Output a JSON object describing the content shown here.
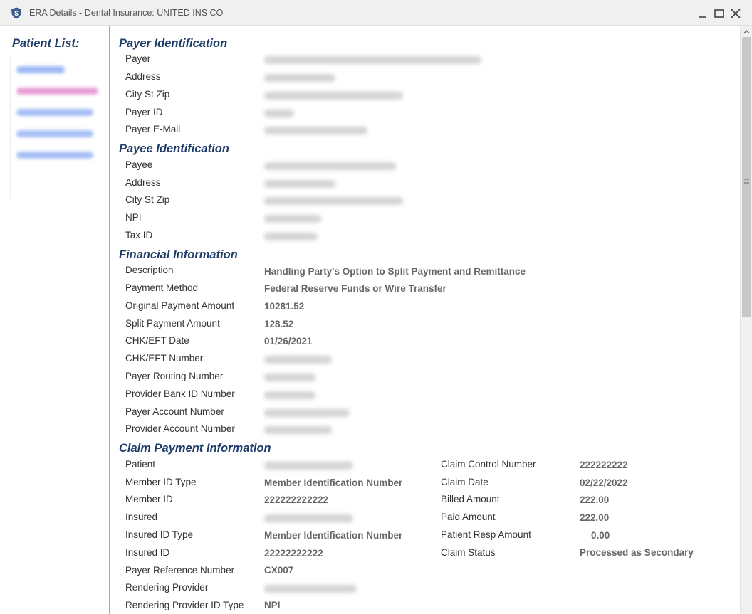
{
  "window": {
    "title": "ERA Details - Dental Insurance: UNITED INS CO",
    "icon": "shield-dollar-icon"
  },
  "sidebar": {
    "title": "Patient List:"
  },
  "payer_identification": {
    "title": "Payer Identification",
    "labels": {
      "payer": "Payer",
      "address": "Address",
      "city_st_zip": "City St Zip",
      "payer_id": "Payer ID",
      "payer_email": "Payer E-Mail"
    }
  },
  "payee_identification": {
    "title": "Payee Identification",
    "labels": {
      "payee": "Payee",
      "address": "Address",
      "city_st_zip": "City St Zip",
      "npi": "NPI",
      "tax_id": "Tax ID"
    }
  },
  "financial_information": {
    "title": "Financial Information",
    "labels": {
      "description": "Description",
      "payment_method": "Payment Method",
      "original_payment_amount": "Original Payment Amount",
      "split_payment_amount": "Split Payment Amount",
      "chk_eft_date": "CHK/EFT Date",
      "chk_eft_number": "CHK/EFT Number",
      "payer_routing_number": "Payer Routing Number",
      "provider_bank_id_number": "Provider Bank ID Number",
      "payer_account_number": "Payer Account Number",
      "provider_account_number": "Provider Account Number"
    },
    "values": {
      "description": "Handling Party's Option to Split Payment and Remittance",
      "payment_method": "Federal Reserve Funds or Wire Transfer",
      "original_payment_amount": "10281.52",
      "split_payment_amount": "128.52",
      "chk_eft_date": "01/26/2021"
    }
  },
  "claim_payment_information": {
    "title": "Claim Payment Information",
    "labels": {
      "patient": "Patient",
      "member_id_type": "Member ID Type",
      "member_id": "Member ID",
      "insured": "Insured",
      "insured_id_type": "Insured ID Type",
      "insured_id": "Insured ID",
      "payer_reference_number": "Payer Reference Number",
      "rendering_provider": "Rendering Provider",
      "rendering_provider_id_type": "Rendering Provider ID Type",
      "claim_control_number": "Claim Control Number",
      "claim_date": "Claim Date",
      "billed_amount": "Billed Amount",
      "paid_amount": "Paid Amount",
      "patient_resp_amount": "Patient Resp Amount",
      "claim_status": "Claim Status"
    },
    "values": {
      "member_id_type": "Member Identification Number",
      "member_id": "222222222222",
      "insured_id_type": "Member Identification Number",
      "insured_id": "22222222222",
      "payer_reference_number": "CX007",
      "rendering_provider_id_type": "NPI",
      "claim_control_number": "222222222",
      "claim_date": "02/22/2022",
      "billed_amount": "222.00",
      "paid_amount": "222.00",
      "patient_resp_amount": "0.00",
      "claim_status": "Processed as Secondary"
    }
  }
}
